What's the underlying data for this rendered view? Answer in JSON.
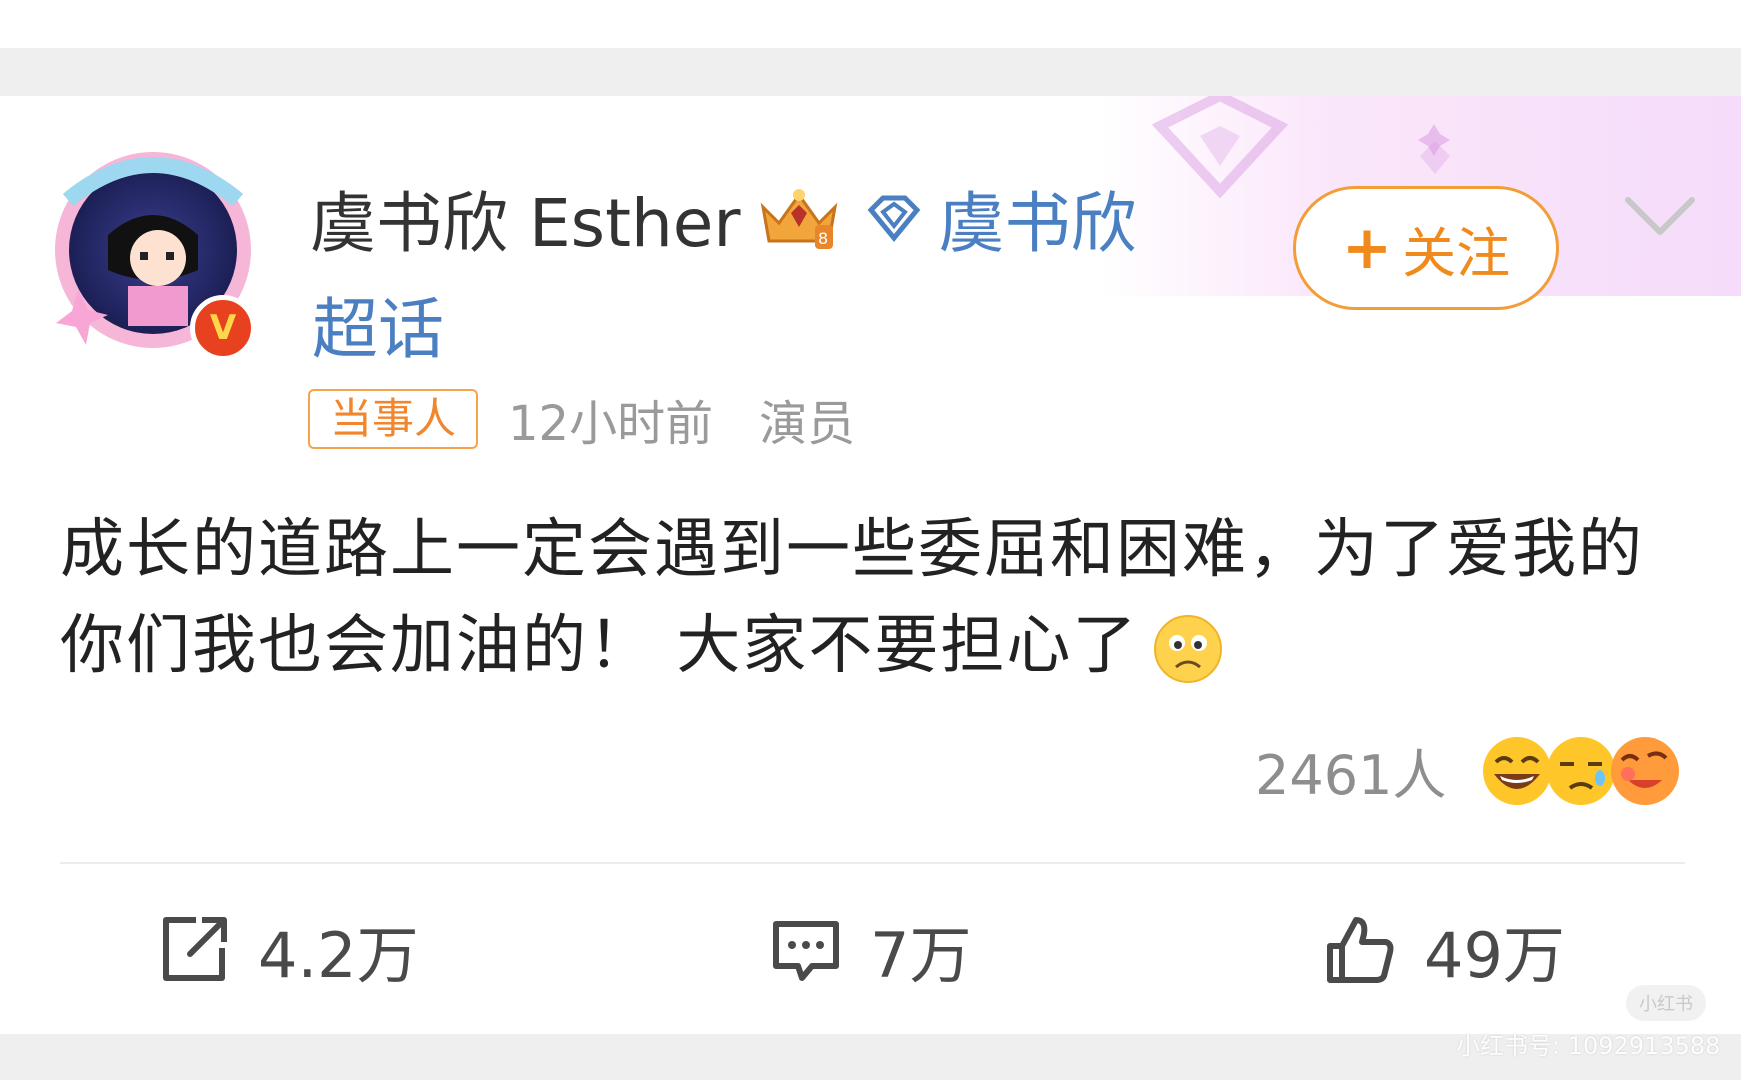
{
  "post": {
    "author": {
      "name": "虞书欣 Esther",
      "verified_badge": "V"
    },
    "topic": {
      "name": "虞书欣",
      "suffix": "超话"
    },
    "follow_button": {
      "plus": "+",
      "label": "关注"
    },
    "meta": {
      "tag": "当事人",
      "time": "12小时前",
      "role": "演员"
    },
    "text": "成长的道路上一定会遇到一些委屈和困难，为了爱我的你们我也会加油的！ 大家不要担心了",
    "reactions": {
      "count": "2461人",
      "faces": [
        "laugh-emoji",
        "cry-emoji",
        "touched-emoji"
      ]
    },
    "actions": {
      "repost": "4.2万",
      "comment": "7万",
      "like": "49万"
    }
  },
  "watermark": {
    "logo": "小红书",
    "text": "小红书号: 1092913588"
  },
  "colors": {
    "accent_orange": "#f08a1c",
    "topic_blue": "#4a7fc1",
    "meta_gray": "#9a9a9a"
  }
}
